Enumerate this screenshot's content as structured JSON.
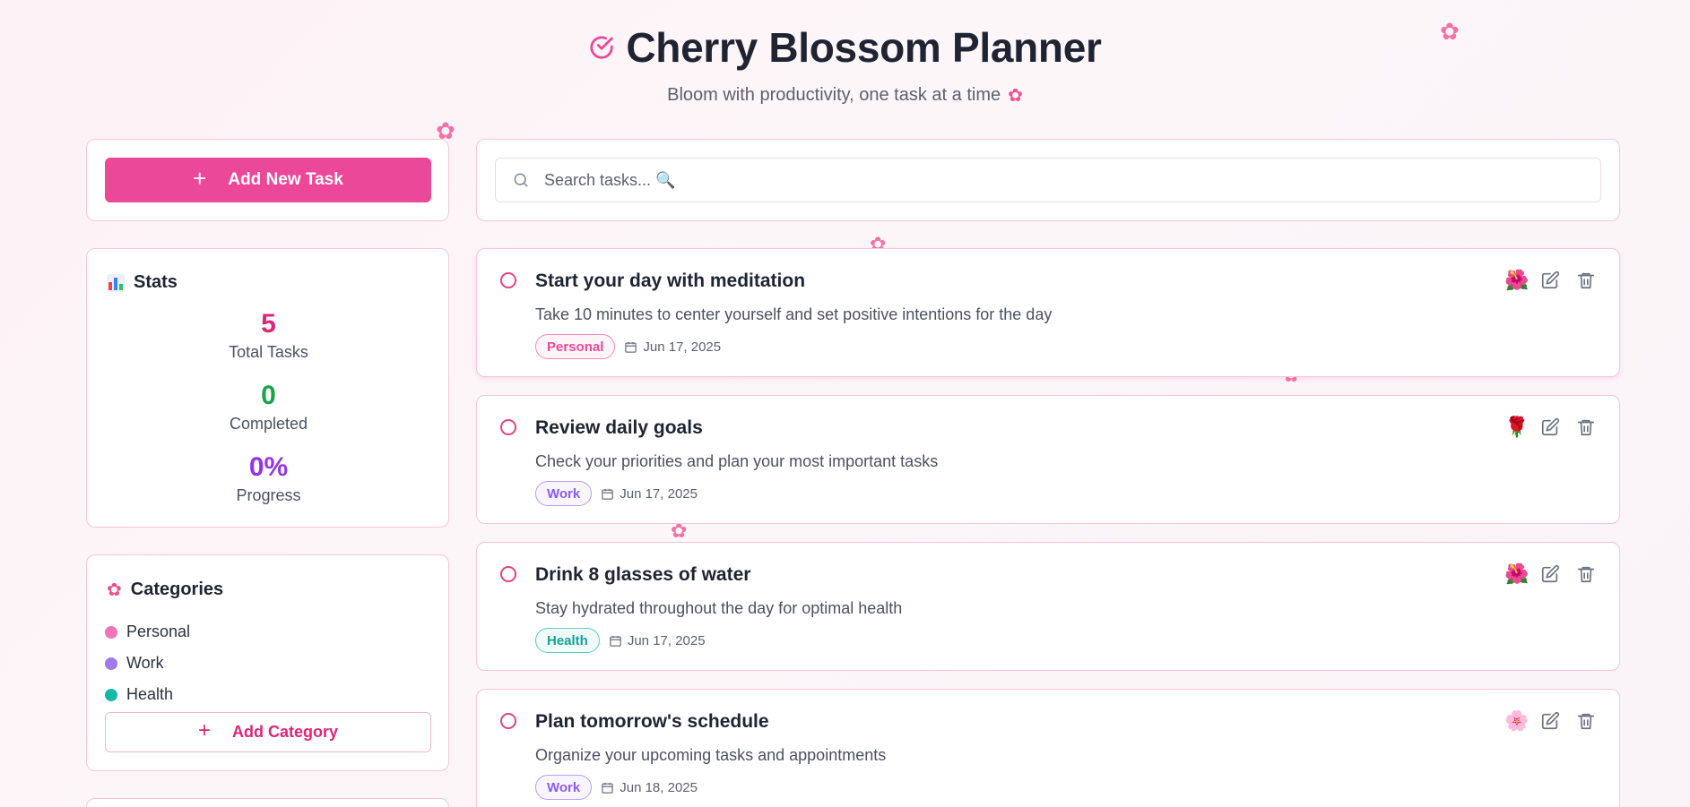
{
  "header": {
    "title": "Cherry Blossom Planner",
    "subtitle": "Bloom with productivity, one task at a time"
  },
  "sidebar": {
    "add_task_label": "Add New Task",
    "stats": {
      "title": "Stats",
      "total": "5",
      "total_label": "Total Tasks",
      "completed": "0",
      "completed_label": "Completed",
      "progress": "0%",
      "progress_label": "Progress"
    },
    "categories": {
      "title": "Categories",
      "items": [
        {
          "label": "Personal",
          "color": "#f472b6"
        },
        {
          "label": "Work",
          "color": "#9f7aea"
        },
        {
          "label": "Health",
          "color": "#14b8a6"
        }
      ],
      "add_label": "Add Category"
    }
  },
  "search": {
    "placeholder": "Search tasks... 🔍"
  },
  "tasks": [
    {
      "title": "Start your day with meditation",
      "description": "Take 10 minutes to center yourself and set positive intentions for the day",
      "category": "Personal",
      "date": "Jun 17, 2025",
      "flower": "🌺"
    },
    {
      "title": "Review daily goals",
      "description": "Check your priorities and plan your most important tasks",
      "category": "Work",
      "date": "Jun 17, 2025",
      "flower": "🌹"
    },
    {
      "title": "Drink 8 glasses of water",
      "description": "Stay hydrated throughout the day for optimal health",
      "category": "Health",
      "date": "Jun 17, 2025",
      "flower": "🌺"
    },
    {
      "title": "Plan tomorrow's schedule",
      "description": "Organize your upcoming tasks and appointments",
      "category": "Work",
      "date": "Jun 18, 2025",
      "flower": "🌸"
    }
  ],
  "colors": {
    "accent": "#ec4899",
    "completed": "#16a34a",
    "progress": "#9333ea",
    "total": "#db2777"
  }
}
